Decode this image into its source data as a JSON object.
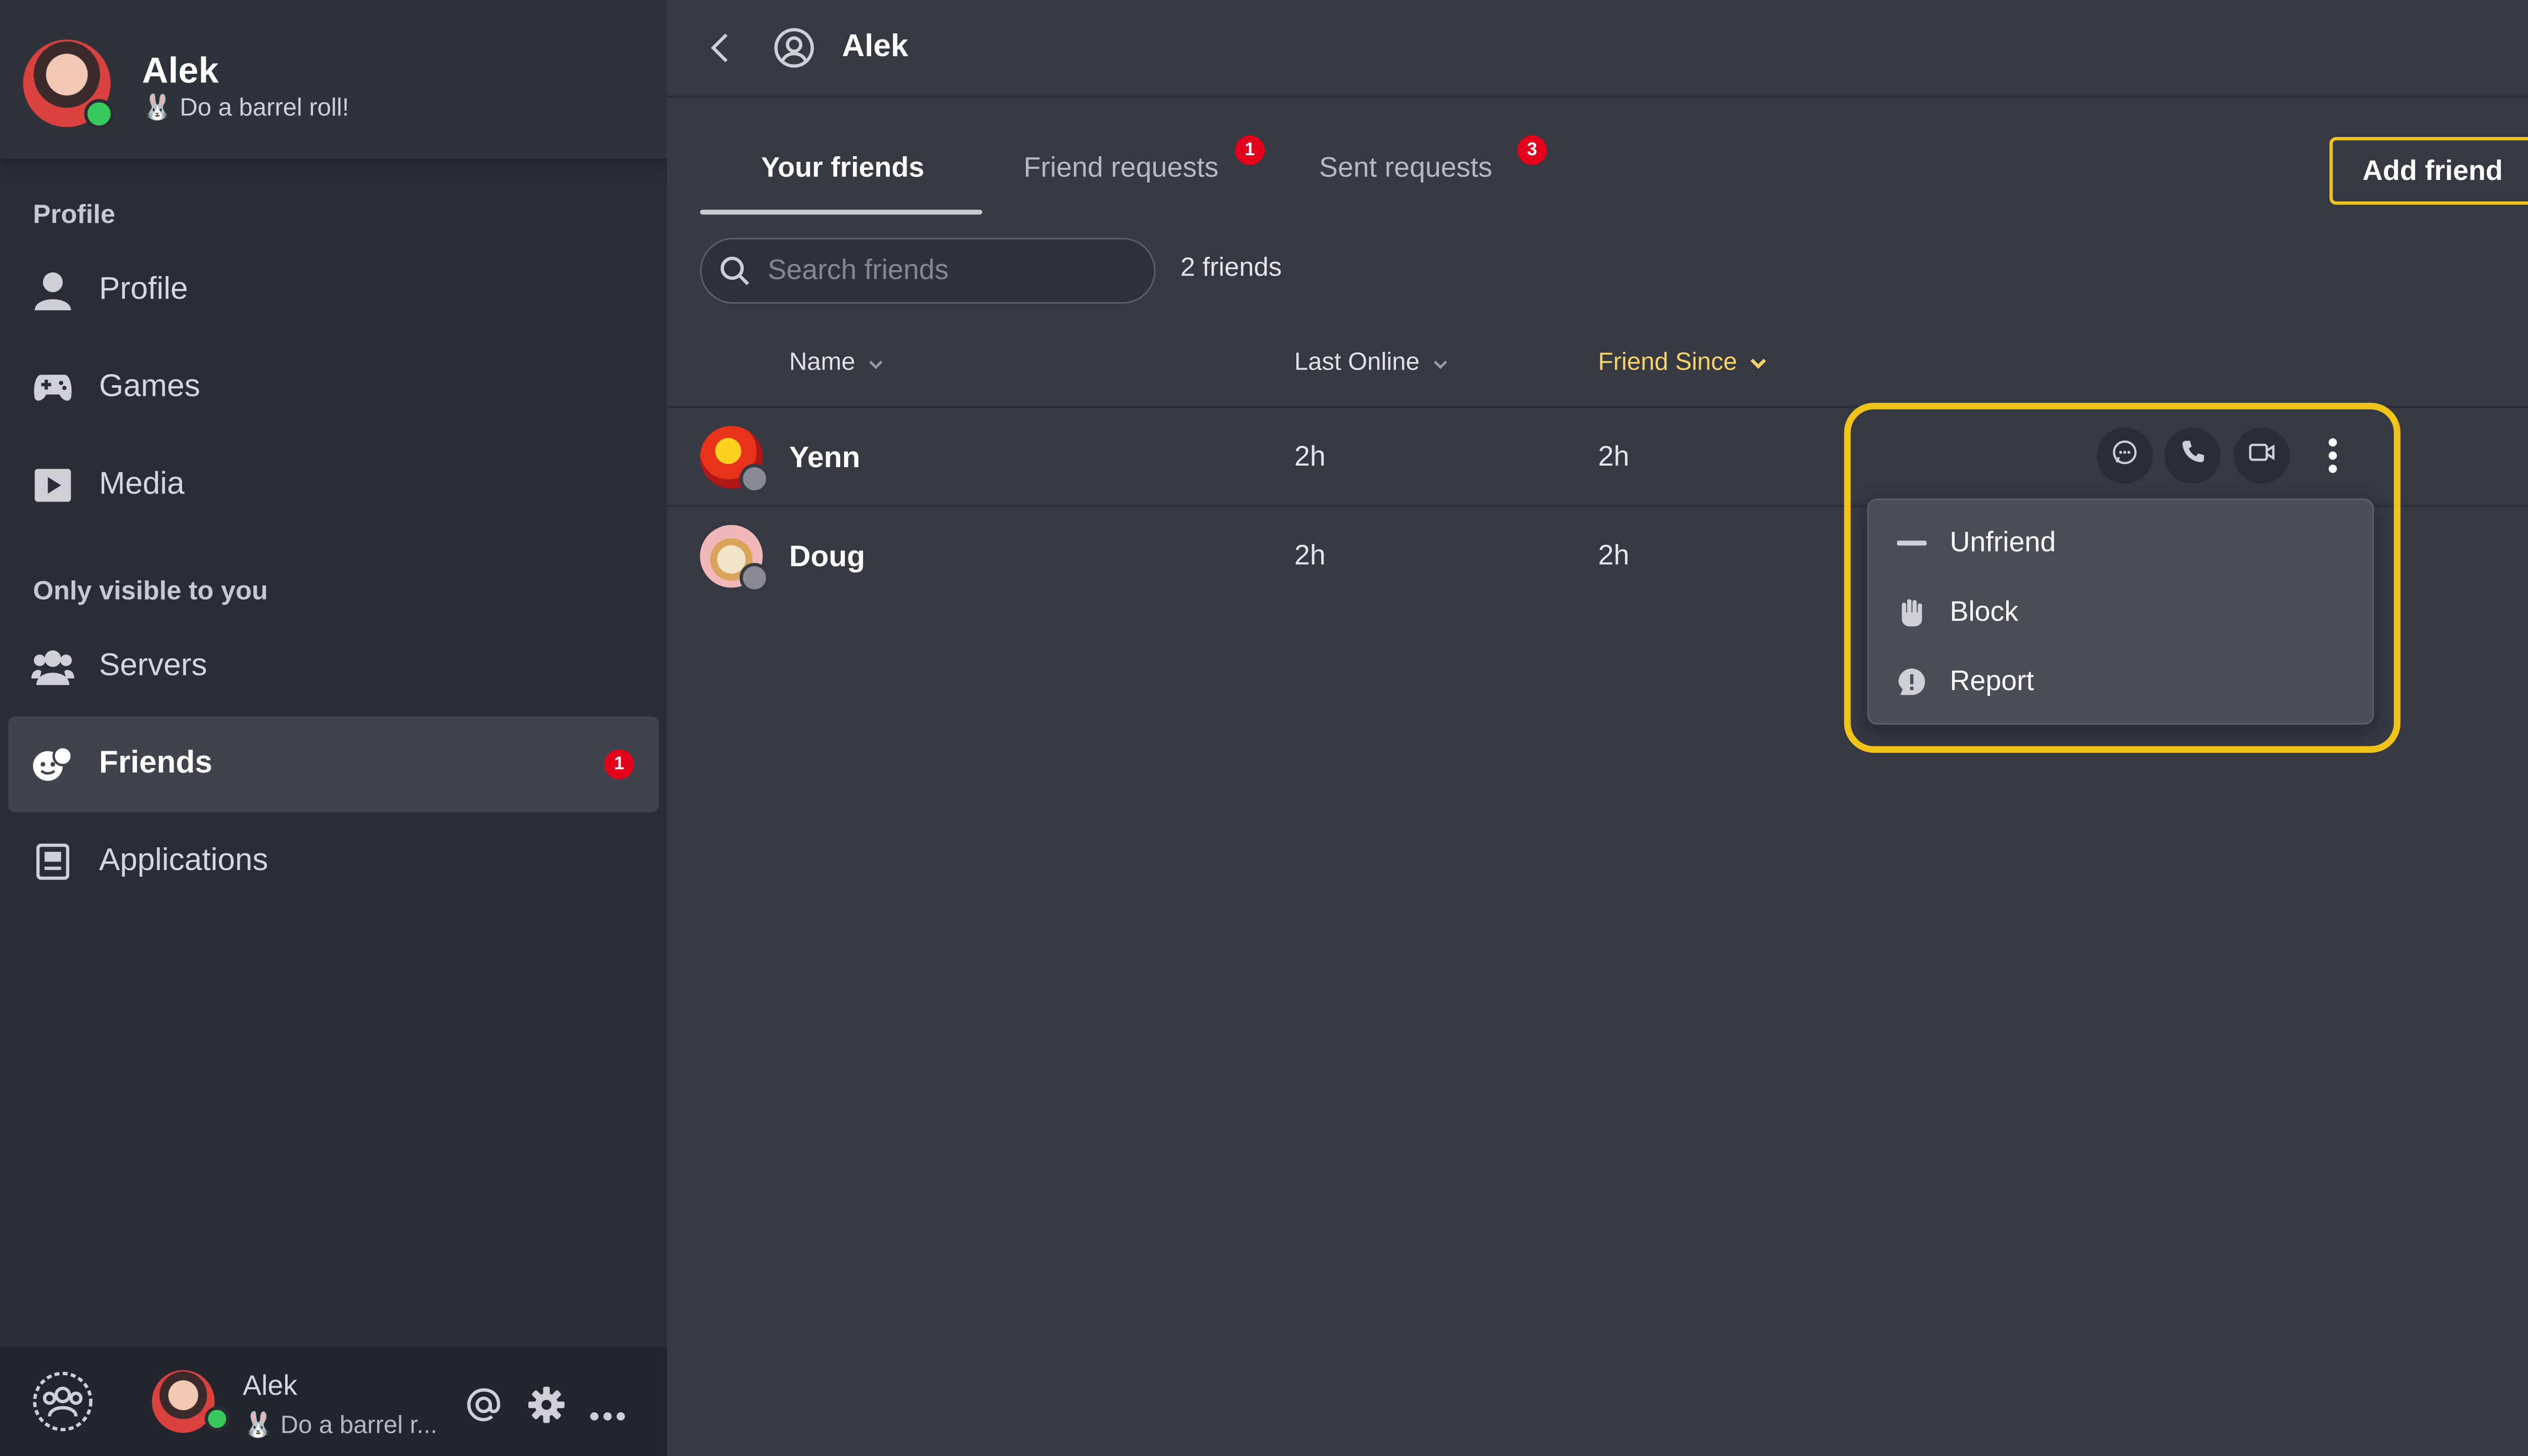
{
  "user": {
    "name": "Alek",
    "status_emoji": "🐰",
    "status": "Do a barrel roll!",
    "status_short": "Do a barrel r..."
  },
  "sidebar": {
    "section_profile": "Profile",
    "section_private": "Only visible to you",
    "items": [
      {
        "label": "Profile",
        "icon": "person-icon"
      },
      {
        "label": "Games",
        "icon": "gamepad-icon"
      },
      {
        "label": "Media",
        "icon": "play-icon"
      },
      {
        "label": "Servers",
        "icon": "group-icon"
      },
      {
        "label": "Friends",
        "icon": "friends-icon",
        "badge": "1",
        "active": true
      },
      {
        "label": "Applications",
        "icon": "applications-icon"
      }
    ]
  },
  "header": {
    "title": "Alek"
  },
  "tabs": [
    {
      "label": "Your friends",
      "active": true
    },
    {
      "label": "Friend requests",
      "badge": "1"
    },
    {
      "label": "Sent requests",
      "badge": "3"
    }
  ],
  "add_friend_label": "Add friend",
  "search": {
    "placeholder": "Search friends",
    "value": ""
  },
  "friend_count": "2 friends",
  "table": {
    "columns": [
      {
        "label": "Name",
        "sorted": false
      },
      {
        "label": "Last Online",
        "sorted": false
      },
      {
        "label": "Friend Since",
        "sorted": true
      }
    ],
    "rows": [
      {
        "name": "Yenn",
        "last_online": "2h",
        "friend_since": "2h"
      },
      {
        "name": "Doug",
        "last_online": "2h",
        "friend_since": "2h"
      }
    ]
  },
  "context_menu": {
    "items": [
      {
        "label": "Unfriend",
        "icon": "minus-icon"
      },
      {
        "label": "Block",
        "icon": "hand-icon"
      },
      {
        "label": "Report",
        "icon": "alert-icon"
      }
    ]
  },
  "colors": {
    "accent": "#f0c419",
    "badge": "#e3001b",
    "online": "#37c95b",
    "background": "#363842",
    "sidebar": "#2b2d35"
  }
}
